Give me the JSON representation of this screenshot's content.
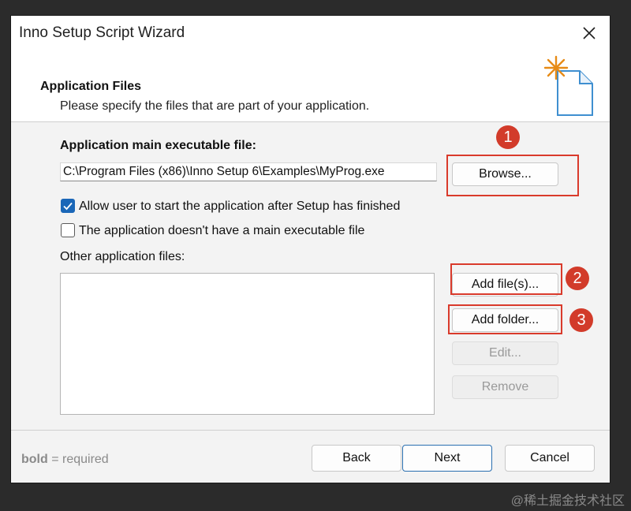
{
  "window": {
    "title": "Inno Setup Script Wizard"
  },
  "header": {
    "title": "Application Files",
    "subtitle": "Please specify the files that are part of your application."
  },
  "main_exe": {
    "label": "Application main executable file:",
    "value": "C:\\Program Files (x86)\\Inno Setup 6\\Examples\\MyProg.exe",
    "browse_label": "Browse..."
  },
  "options": {
    "allow_start": {
      "label": "Allow user to start the application after Setup has finished",
      "checked": true
    },
    "no_main_exe": {
      "label": "The application doesn't have a main executable file",
      "checked": false
    }
  },
  "other_files": {
    "label": "Other application files:",
    "items": [],
    "add_files_label": "Add file(s)...",
    "add_folder_label": "Add folder...",
    "edit_label": "Edit...",
    "remove_label": "Remove"
  },
  "annotations": [
    "1",
    "2",
    "3"
  ],
  "footer": {
    "legend_bold": "bold",
    "legend_rest": " = required",
    "back_label": "Back",
    "next_label": "Next",
    "cancel_label": "Cancel"
  },
  "watermark": "@稀土掘金技术社区",
  "colors": {
    "accent": "#1a67b8",
    "annotation": "#d23b2a"
  }
}
